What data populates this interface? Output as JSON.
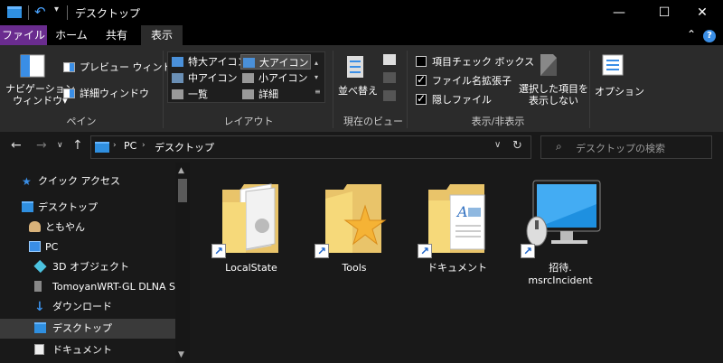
{
  "window": {
    "title": "デスクトップ",
    "minimize": "—",
    "maximize": "☐",
    "close": "✕"
  },
  "tabs": [
    {
      "label": "ファイル"
    },
    {
      "label": "ホーム"
    },
    {
      "label": "共有"
    },
    {
      "label": "表示"
    }
  ],
  "ribbon": {
    "pane": {
      "nav_pane_label": "ナビゲーション\nウィンドウ▾",
      "preview": "プレビュー ウィンドウ",
      "details": "詳細ウィンドウ",
      "group": "ペイン"
    },
    "layout": {
      "items": [
        "特大アイコン",
        "大アイコン",
        "中アイコン",
        "小アイコン",
        "一覧",
        "詳細"
      ],
      "group": "レイアウト"
    },
    "current_view": {
      "sort": "並べ替え",
      "group": "現在のビュー"
    },
    "show_hide": {
      "item_checkboxes": "項目チェック ボックス",
      "file_extensions": "ファイル名拡張子",
      "hidden_items": "隠しファイル",
      "hide_selected": "選択した項目を\n表示しない",
      "group": "表示/非表示"
    },
    "options": "オプション"
  },
  "address": {
    "path": [
      "PC",
      "デスクトップ"
    ],
    "search_placeholder": "デスクトップの検索"
  },
  "nav_pane": {
    "items": [
      {
        "label": "クイック アクセス",
        "icon": "star-icon"
      },
      {
        "label": "デスクトップ",
        "icon": "desktop-icon"
      },
      {
        "label": "ともやん",
        "icon": "user-icon"
      },
      {
        "label": "PC",
        "icon": "pc-icon"
      },
      {
        "label": "3D オブジェクト",
        "icon": "3d-objects-icon"
      },
      {
        "label": "TomoyanWRT-GL DLNA Serv",
        "icon": "dlna-icon"
      },
      {
        "label": "ダウンロード",
        "icon": "download-icon"
      },
      {
        "label": "デスクトップ",
        "icon": "desktop-icon"
      },
      {
        "label": "ドキュメント",
        "icon": "documents-icon"
      }
    ]
  },
  "files": [
    {
      "name": "LocalState",
      "type": "folder-shortcut"
    },
    {
      "name": "Tools",
      "type": "folder-shortcut"
    },
    {
      "name": "ドキュメント",
      "type": "folder-shortcut"
    },
    {
      "name": "招待.\nmsrcIncident",
      "type": "app-shortcut"
    }
  ],
  "colors": {
    "file_tab": "#6a2c8f",
    "accent": "#2f8fe0",
    "folder": "#e9c46a"
  }
}
